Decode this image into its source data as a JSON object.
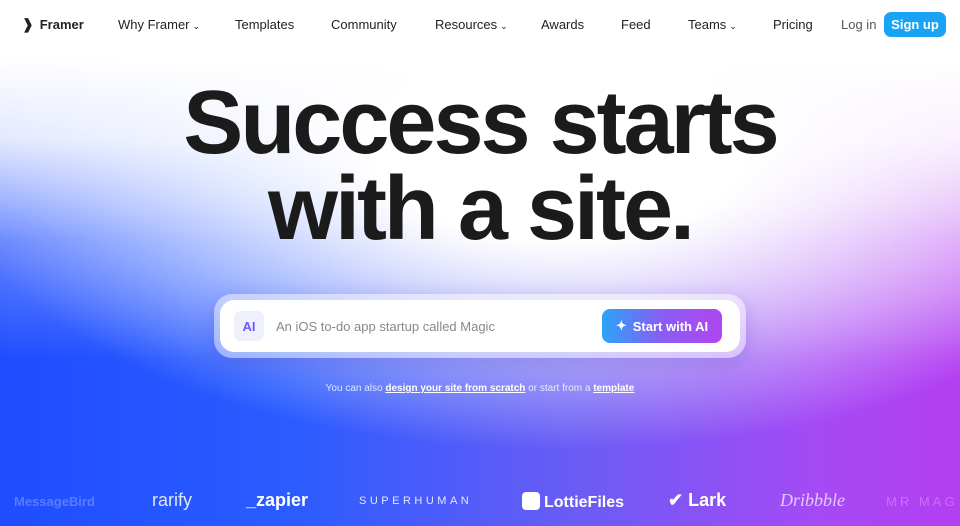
{
  "nav": {
    "brand": "Framer",
    "items": [
      {
        "label": "Why Framer",
        "dropdown": true
      },
      {
        "label": "Templates"
      },
      {
        "label": "Community"
      },
      {
        "label": "Resources",
        "dropdown": true
      },
      {
        "label": "Awards"
      },
      {
        "label": "Feed"
      },
      {
        "label": "Teams",
        "dropdown": true
      },
      {
        "label": "Pricing"
      }
    ],
    "login": "Log in",
    "signup": "Sign up"
  },
  "hero": {
    "line1": "Success starts",
    "line2": "with a site."
  },
  "prompt": {
    "badge": "AI",
    "placeholder": "An iOS to-do app startup called Magic",
    "button": "Start with AI",
    "button_icon": "sparkle-icon"
  },
  "sub": {
    "prefix": "You can also ",
    "link1": "design your site from scratch",
    "middle": " or start from a ",
    "link2": "template"
  },
  "logos": [
    "MessageBird",
    "rarify",
    "_zapier",
    "SUPERHUMAN",
    "LottieFiles",
    "Lark",
    "Dribbble",
    "MR MAG"
  ],
  "colors": {
    "signup": "#1aa3f5",
    "gradient_left": "#1f4dff",
    "gradient_right": "#b43ef2"
  }
}
